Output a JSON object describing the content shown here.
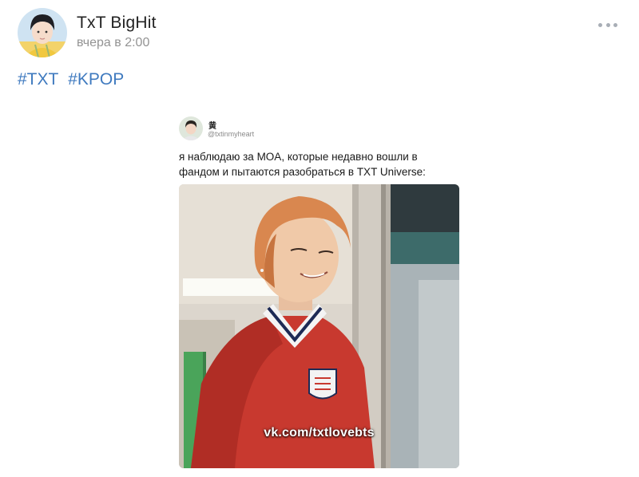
{
  "post": {
    "author": "TxT BigHit",
    "timestamp": "вчера в 2:00",
    "hashtags": [
      "#TXT",
      "#KPOP"
    ],
    "more_icon": "more-horizontal-icon"
  },
  "embedded_tweet": {
    "display_name": "黄",
    "handle": "@txtinmyheart",
    "text_lines": [
      "я наблюдаю за MOA, которые недавно вошли в",
      "фандом и пытаются разобраться в TXT Universe:"
    ],
    "image_watermark": "vk.com/txtlovebts"
  },
  "colors": {
    "link": "#3f7abf",
    "author": "#222222",
    "meta": "#939393"
  }
}
